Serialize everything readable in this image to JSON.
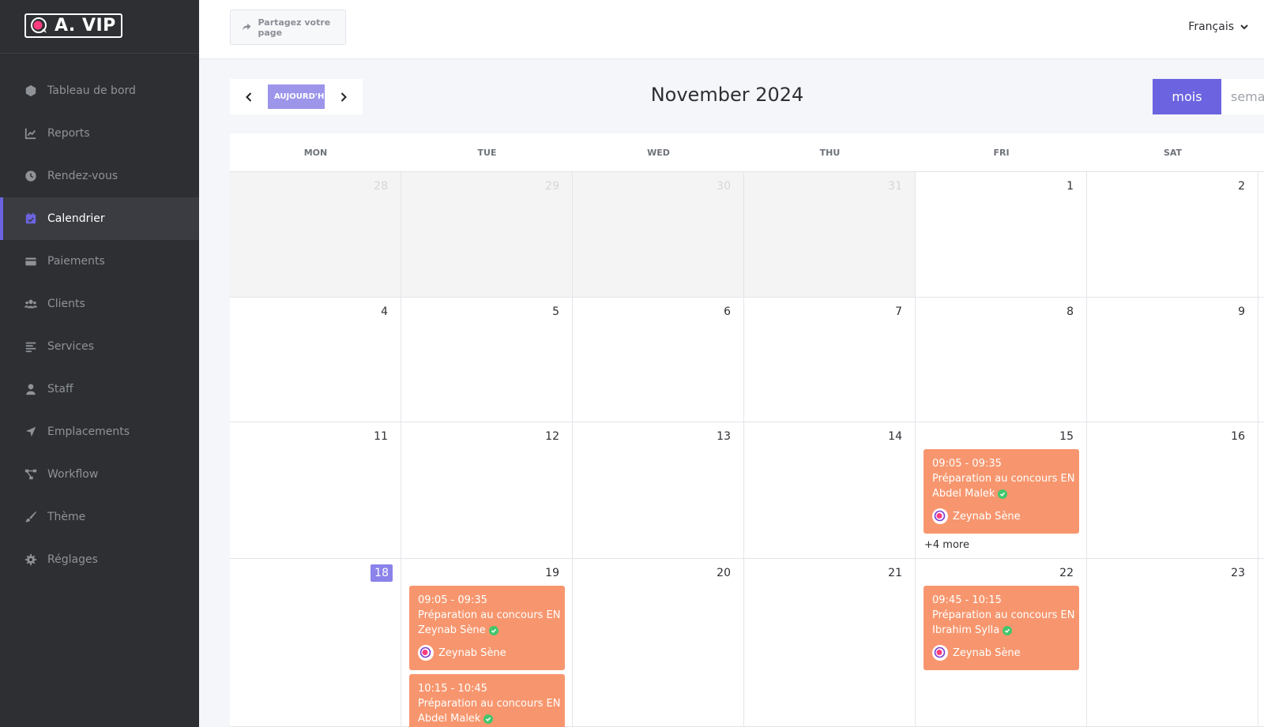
{
  "brand": {
    "name": "A. VIP"
  },
  "sidebar": {
    "items": [
      {
        "label": "Tableau de bord",
        "icon": "cube-icon"
      },
      {
        "label": "Reports",
        "icon": "chart-line-icon"
      },
      {
        "label": "Rendez-vous",
        "icon": "clock-icon"
      },
      {
        "label": "Calendrier",
        "icon": "calendar-check-icon",
        "active": true
      },
      {
        "label": "Paiements",
        "icon": "wallet-icon"
      },
      {
        "label": "Clients",
        "icon": "users-icon"
      },
      {
        "label": "Services",
        "icon": "list-icon"
      },
      {
        "label": "Staff",
        "icon": "user-icon"
      },
      {
        "label": "Emplacements",
        "icon": "location-arrow-icon"
      },
      {
        "label": "Workflow",
        "icon": "workflow-icon"
      },
      {
        "label": "Thème",
        "icon": "brush-icon"
      },
      {
        "label": "Réglages",
        "icon": "gear-icon"
      }
    ]
  },
  "topbar": {
    "share_label": "Partagez votre page",
    "language": "Français"
  },
  "calendar": {
    "title": "November 2024",
    "today_label": "AUJOURD'HUI",
    "views": [
      "mois",
      "semaine"
    ],
    "active_view": "mois",
    "weekdays": [
      "MON",
      "TUE",
      "WED",
      "THU",
      "FRI",
      "SAT"
    ],
    "weeks": [
      {
        "days": [
          {
            "n": "28",
            "other": true
          },
          {
            "n": "29",
            "other": true
          },
          {
            "n": "30",
            "other": true
          },
          {
            "n": "31",
            "other": true
          },
          {
            "n": "1"
          },
          {
            "n": "2"
          }
        ]
      },
      {
        "days": [
          {
            "n": "4"
          },
          {
            "n": "5"
          },
          {
            "n": "6"
          },
          {
            "n": "7"
          },
          {
            "n": "8"
          },
          {
            "n": "9"
          }
        ]
      },
      {
        "days": [
          {
            "n": "11"
          },
          {
            "n": "12"
          },
          {
            "n": "13"
          },
          {
            "n": "14"
          },
          {
            "n": "15"
          },
          {
            "n": "16"
          }
        ]
      },
      {
        "days": [
          {
            "n": "18",
            "today": true
          },
          {
            "n": "19"
          },
          {
            "n": "20"
          },
          {
            "n": "21"
          },
          {
            "n": "22"
          },
          {
            "n": "23"
          }
        ]
      }
    ],
    "events": [
      {
        "week": 2,
        "day": 4,
        "time": "09:05 - 09:35",
        "title": "Préparation au concours EN",
        "client": "Abdel Malek",
        "staff": "Zeynab Sène"
      },
      {
        "week": 3,
        "day": 1,
        "time": "09:05 - 09:35",
        "title": "Préparation au concours EN",
        "client": "Zeynab Sène",
        "staff": "Zeynab Sène"
      },
      {
        "week": 3,
        "day": 1,
        "time": "10:15 - 10:45",
        "title": "Préparation au concours EN",
        "client": "Abdel Malek",
        "staff": ""
      },
      {
        "week": 3,
        "day": 4,
        "time": "09:45 - 10:15",
        "title": "Préparation au concours EN",
        "client": "Ibrahim Sylla",
        "staff": "Zeynab Sène"
      }
    ],
    "more_links": [
      {
        "week": 2,
        "day": 4,
        "label": "+4 more"
      }
    ]
  },
  "colors": {
    "accent": "#6c63e0",
    "today_button": "#9c95ea",
    "event": "#f7966e",
    "sidebar": "#2d2f33",
    "check": "#42c66b"
  }
}
